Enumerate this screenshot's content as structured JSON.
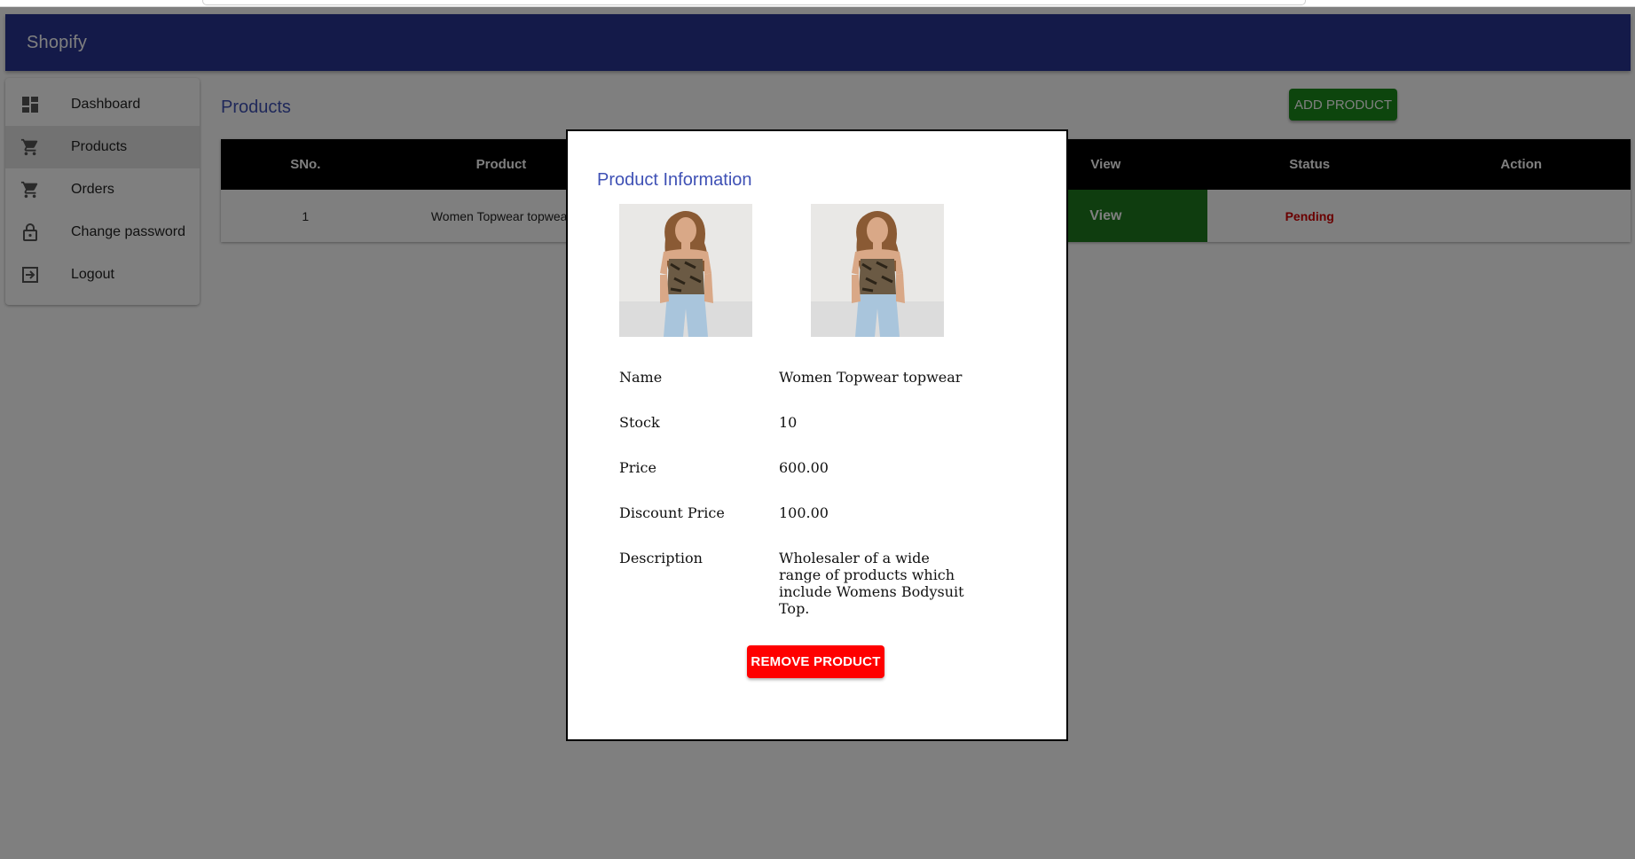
{
  "app": {
    "brand": "Shopify"
  },
  "sidebar": {
    "items": [
      {
        "label": "Dashboard",
        "icon": "dashboard-icon"
      },
      {
        "label": "Products",
        "icon": "cart-icon",
        "active": true
      },
      {
        "label": "Orders",
        "icon": "cart-icon"
      },
      {
        "label": "Change password",
        "icon": "lock-icon"
      },
      {
        "label": "Logout",
        "icon": "logout-icon"
      }
    ]
  },
  "main": {
    "title": "Products",
    "add_button": "ADD PRODUCT",
    "table": {
      "headers": [
        "SNo.",
        "Product",
        "",
        "",
        "View",
        "Status",
        "Action"
      ],
      "rows": [
        {
          "sno": "1",
          "product": "Women Topwear topwear",
          "view": "View",
          "status": "Pending",
          "action": ""
        }
      ]
    }
  },
  "modal": {
    "title": "Product Information",
    "fields": {
      "name": {
        "label": "Name",
        "value": "Women Topwear topwear"
      },
      "stock": {
        "label": "Stock",
        "value": "10"
      },
      "price": {
        "label": "Price",
        "value": "600.00"
      },
      "discount": {
        "label": "Discount Price",
        "value": "100.00"
      },
      "description": {
        "label": "Description",
        "value": "Wholesaler of a wide range of products which include Womens Bodysuit Top."
      }
    },
    "remove_button": "REMOVE PRODUCT"
  },
  "colors": {
    "appbar": "#283593",
    "accent": "#3f51b5",
    "add_button": "#1b8a1b",
    "view_cell": "#1f7a1f",
    "status_pending": "#d50000",
    "remove_button": "#ff0000"
  }
}
